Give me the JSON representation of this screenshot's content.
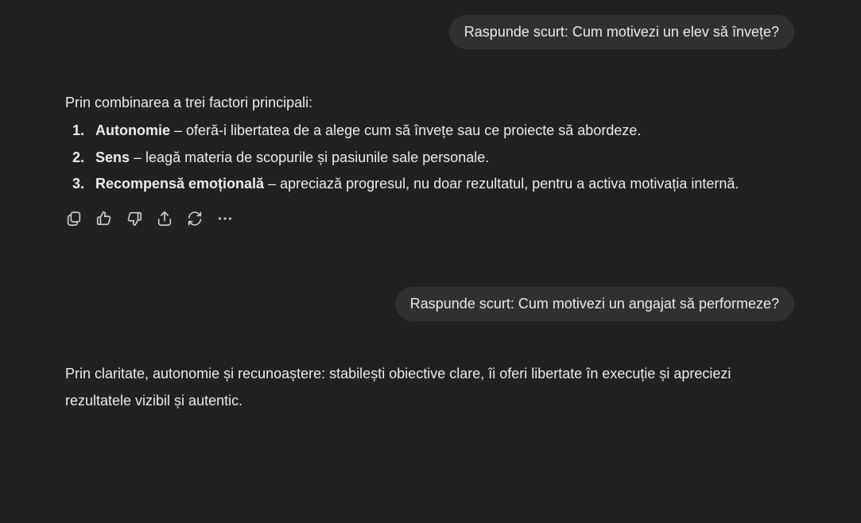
{
  "conversation": [
    {
      "role": "user",
      "text": "Raspunde scurt: Cum motivezi un elev să învețe?"
    },
    {
      "role": "assistant",
      "intro": "Prin combinarea a trei factori principali:",
      "items": [
        {
          "number": "1.",
          "term": "Autonomie",
          "text": " – oferă-i libertatea de a alege cum să învețe sau ce proiecte să abordeze."
        },
        {
          "number": "2.",
          "term": "Sens",
          "text": " – leagă materia de scopurile și pasiunile sale personale."
        },
        {
          "number": "3.",
          "term": "Recompensă emoțională",
          "text": " – apreciază progresul, nu doar rezultatul, pentru a activa motivația internă."
        }
      ],
      "actions": [
        "copy-icon",
        "thumbs-up-icon",
        "thumbs-down-icon",
        "share-icon",
        "regenerate-icon",
        "more-icon"
      ]
    },
    {
      "role": "user",
      "text": "Raspunde scurt: Cum motivezi un angajat să performeze?"
    },
    {
      "role": "assistant",
      "text": "Prin claritate, autonomie și recunoaștere: stabilești obiective clare, îi oferi libertate în execuție și apreciezi rezultatele vizibil și autentic."
    }
  ],
  "colors": {
    "background": "#212121",
    "bubble": "#303030",
    "text": "#ececec",
    "icon": "#d0d0d0"
  }
}
